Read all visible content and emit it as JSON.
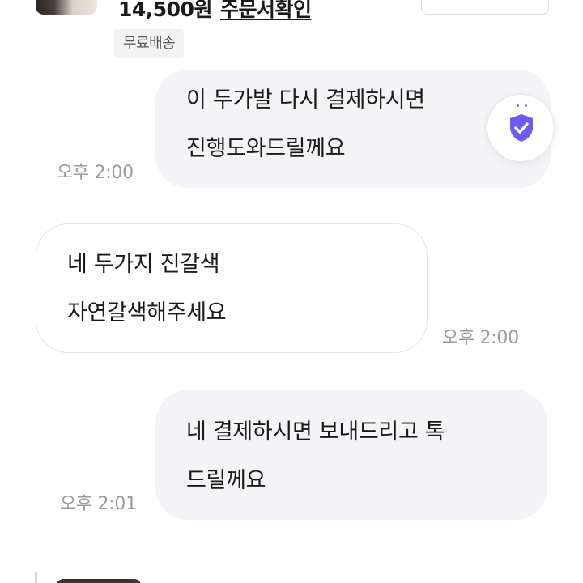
{
  "product": {
    "price": "14,500원",
    "order_link": "주문서확인",
    "shipping_badge": "무료배송"
  },
  "messages": [
    {
      "sender": "me",
      "lines": [
        "이 두가발 다시 결제하시면",
        "진행도와드릴께요"
      ],
      "time": "오후 2:00"
    },
    {
      "sender": "other",
      "lines": [
        "네 두가지 진갈색",
        "자연갈색해주세요"
      ],
      "time": "오후 2:00"
    },
    {
      "sender": "me",
      "lines": [
        "네 결제하시면 보내드리고 톡",
        "드릴께요"
      ],
      "time": "오후 2:01"
    }
  ],
  "icons": {
    "safety_badge": "shield-check-icon",
    "accent_color": "#6b5cf5"
  }
}
